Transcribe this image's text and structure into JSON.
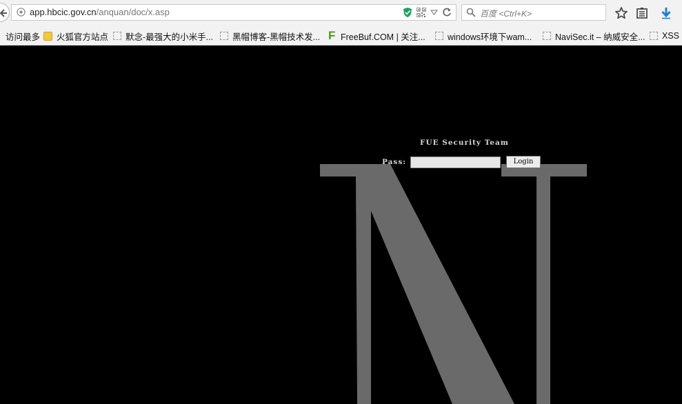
{
  "browser": {
    "url_host": "app.hbcic.gov.cn",
    "url_path": "/anquan/doc/x.asp",
    "search_placeholder": "百度 <Ctrl+K>"
  },
  "bookmarks": [
    {
      "label": "访问最多",
      "icon": "none"
    },
    {
      "label": "火狐官方站点",
      "icon": "folder-icon"
    },
    {
      "label": "默念-最强大的小米手...",
      "icon": "page-icon"
    },
    {
      "label": "黑帽博客-黑帽技术发...",
      "icon": "page-icon"
    },
    {
      "label": "FreeBuf.COM | 关注...",
      "icon": "freebuf-icon"
    },
    {
      "label": "windows环境下wam...",
      "icon": "page-icon"
    },
    {
      "label": "NaviSec.it – 纳威安全...",
      "icon": "page-icon"
    },
    {
      "label": "XSS",
      "icon": "page-icon"
    }
  ],
  "page": {
    "team": "FUE Security Team",
    "pass_label": "Pass:",
    "pass_value": "",
    "login_label": "Login",
    "big_letter": "N",
    "big_letter_color": "#6a6a6a"
  }
}
